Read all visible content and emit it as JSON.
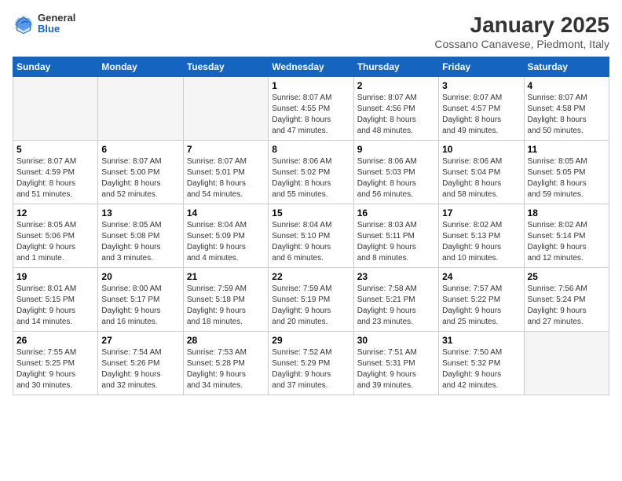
{
  "header": {
    "logo": {
      "general": "General",
      "blue": "Blue"
    },
    "title": "January 2025",
    "location": "Cossano Canavese, Piedmont, Italy"
  },
  "calendar": {
    "weekdays": [
      "Sunday",
      "Monday",
      "Tuesday",
      "Wednesday",
      "Thursday",
      "Friday",
      "Saturday"
    ],
    "weeks": [
      [
        {
          "day": "",
          "info": ""
        },
        {
          "day": "",
          "info": ""
        },
        {
          "day": "",
          "info": ""
        },
        {
          "day": "1",
          "info": "Sunrise: 8:07 AM\nSunset: 4:55 PM\nDaylight: 8 hours\nand 47 minutes."
        },
        {
          "day": "2",
          "info": "Sunrise: 8:07 AM\nSunset: 4:56 PM\nDaylight: 8 hours\nand 48 minutes."
        },
        {
          "day": "3",
          "info": "Sunrise: 8:07 AM\nSunset: 4:57 PM\nDaylight: 8 hours\nand 49 minutes."
        },
        {
          "day": "4",
          "info": "Sunrise: 8:07 AM\nSunset: 4:58 PM\nDaylight: 8 hours\nand 50 minutes."
        }
      ],
      [
        {
          "day": "5",
          "info": "Sunrise: 8:07 AM\nSunset: 4:59 PM\nDaylight: 8 hours\nand 51 minutes."
        },
        {
          "day": "6",
          "info": "Sunrise: 8:07 AM\nSunset: 5:00 PM\nDaylight: 8 hours\nand 52 minutes."
        },
        {
          "day": "7",
          "info": "Sunrise: 8:07 AM\nSunset: 5:01 PM\nDaylight: 8 hours\nand 54 minutes."
        },
        {
          "day": "8",
          "info": "Sunrise: 8:06 AM\nSunset: 5:02 PM\nDaylight: 8 hours\nand 55 minutes."
        },
        {
          "day": "9",
          "info": "Sunrise: 8:06 AM\nSunset: 5:03 PM\nDaylight: 8 hours\nand 56 minutes."
        },
        {
          "day": "10",
          "info": "Sunrise: 8:06 AM\nSunset: 5:04 PM\nDaylight: 8 hours\nand 58 minutes."
        },
        {
          "day": "11",
          "info": "Sunrise: 8:05 AM\nSunset: 5:05 PM\nDaylight: 8 hours\nand 59 minutes."
        }
      ],
      [
        {
          "day": "12",
          "info": "Sunrise: 8:05 AM\nSunset: 5:06 PM\nDaylight: 9 hours\nand 1 minute."
        },
        {
          "day": "13",
          "info": "Sunrise: 8:05 AM\nSunset: 5:08 PM\nDaylight: 9 hours\nand 3 minutes."
        },
        {
          "day": "14",
          "info": "Sunrise: 8:04 AM\nSunset: 5:09 PM\nDaylight: 9 hours\nand 4 minutes."
        },
        {
          "day": "15",
          "info": "Sunrise: 8:04 AM\nSunset: 5:10 PM\nDaylight: 9 hours\nand 6 minutes."
        },
        {
          "day": "16",
          "info": "Sunrise: 8:03 AM\nSunset: 5:11 PM\nDaylight: 9 hours\nand 8 minutes."
        },
        {
          "day": "17",
          "info": "Sunrise: 8:02 AM\nSunset: 5:13 PM\nDaylight: 9 hours\nand 10 minutes."
        },
        {
          "day": "18",
          "info": "Sunrise: 8:02 AM\nSunset: 5:14 PM\nDaylight: 9 hours\nand 12 minutes."
        }
      ],
      [
        {
          "day": "19",
          "info": "Sunrise: 8:01 AM\nSunset: 5:15 PM\nDaylight: 9 hours\nand 14 minutes."
        },
        {
          "day": "20",
          "info": "Sunrise: 8:00 AM\nSunset: 5:17 PM\nDaylight: 9 hours\nand 16 minutes."
        },
        {
          "day": "21",
          "info": "Sunrise: 7:59 AM\nSunset: 5:18 PM\nDaylight: 9 hours\nand 18 minutes."
        },
        {
          "day": "22",
          "info": "Sunrise: 7:59 AM\nSunset: 5:19 PM\nDaylight: 9 hours\nand 20 minutes."
        },
        {
          "day": "23",
          "info": "Sunrise: 7:58 AM\nSunset: 5:21 PM\nDaylight: 9 hours\nand 23 minutes."
        },
        {
          "day": "24",
          "info": "Sunrise: 7:57 AM\nSunset: 5:22 PM\nDaylight: 9 hours\nand 25 minutes."
        },
        {
          "day": "25",
          "info": "Sunrise: 7:56 AM\nSunset: 5:24 PM\nDaylight: 9 hours\nand 27 minutes."
        }
      ],
      [
        {
          "day": "26",
          "info": "Sunrise: 7:55 AM\nSunset: 5:25 PM\nDaylight: 9 hours\nand 30 minutes."
        },
        {
          "day": "27",
          "info": "Sunrise: 7:54 AM\nSunset: 5:26 PM\nDaylight: 9 hours\nand 32 minutes."
        },
        {
          "day": "28",
          "info": "Sunrise: 7:53 AM\nSunset: 5:28 PM\nDaylight: 9 hours\nand 34 minutes."
        },
        {
          "day": "29",
          "info": "Sunrise: 7:52 AM\nSunset: 5:29 PM\nDaylight: 9 hours\nand 37 minutes."
        },
        {
          "day": "30",
          "info": "Sunrise: 7:51 AM\nSunset: 5:31 PM\nDaylight: 9 hours\nand 39 minutes."
        },
        {
          "day": "31",
          "info": "Sunrise: 7:50 AM\nSunset: 5:32 PM\nDaylight: 9 hours\nand 42 minutes."
        },
        {
          "day": "",
          "info": ""
        }
      ]
    ]
  }
}
